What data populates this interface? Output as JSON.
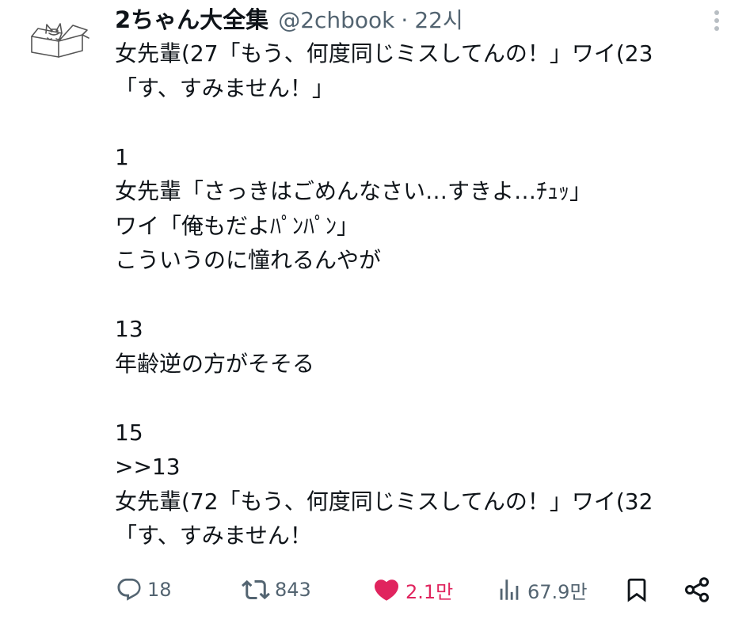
{
  "tweet": {
    "display_name": "2ちゃん大全集",
    "handle": "@2chbook",
    "separator": "·",
    "time": "22시",
    "lines": [
      "女先輩(27「もう、何度同じミスしてんの！」ワイ(23",
      "「す、すみません！」",
      "",
      "1",
      "女先輩「さっきはごめんなさい…すきよ…ﾁｭｯ」",
      "ワイ「俺もだよﾊﾟﾝﾊﾟﾝ」",
      "こういうのに憧れるんやが",
      "",
      "13",
      "年齢逆の方がそそる",
      "",
      "15",
      ">>13",
      "女先輩(72「もう、何度同じミスしてんの！」ワイ(32",
      "「す、すみません！"
    ]
  },
  "actions": {
    "replies": "18",
    "retweets": "843",
    "likes": "2.1만",
    "views": "67.9만"
  },
  "icons": {
    "avatar": "cat-in-box-avatar",
    "more": "more-vertical-icon",
    "reply": "reply-bubble-icon",
    "retweet": "retweet-icon",
    "like": "heart-icon",
    "views": "analytics-bars-icon",
    "bookmark": "bookmark-icon",
    "share": "share-icon"
  },
  "colors": {
    "text": "#0f1419",
    "secondary": "#536471",
    "like": "#e0245e",
    "background": "#ffffff"
  }
}
